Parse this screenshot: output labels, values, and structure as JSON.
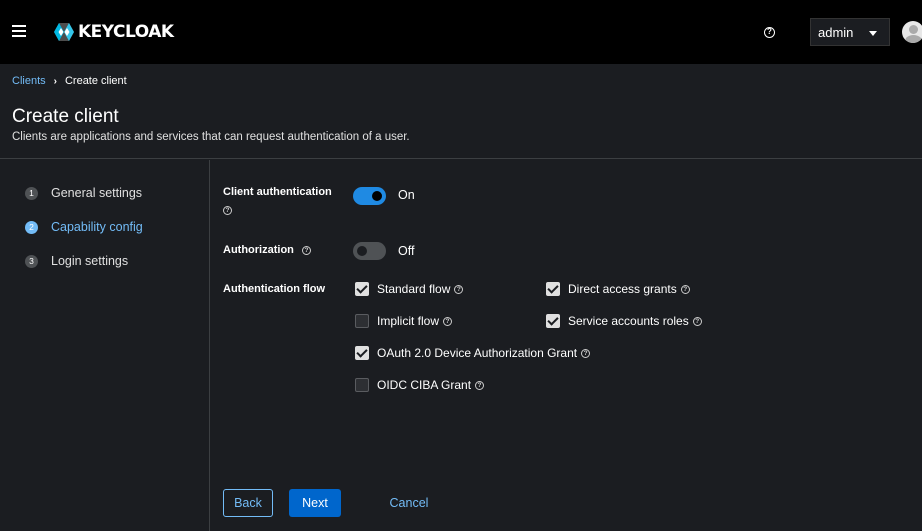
{
  "topbar": {
    "logo_text": "KEYCLOAK",
    "user_label": "admin"
  },
  "breadcrumb": {
    "parent": "Clients",
    "current": "Create client"
  },
  "page": {
    "title": "Create client",
    "description": "Clients are applications and services that can request authentication of a user."
  },
  "steps": [
    {
      "number": "1",
      "label": "General settings"
    },
    {
      "number": "2",
      "label": "Capability config"
    },
    {
      "number": "3",
      "label": "Login settings"
    }
  ],
  "form": {
    "client_auth": {
      "label": "Client authentication",
      "state": "On"
    },
    "authorization": {
      "label": "Authorization",
      "state": "Off"
    },
    "auth_flow_label": "Authentication flow",
    "flows": {
      "standard": "Standard flow",
      "direct": "Direct access grants",
      "implicit": "Implicit flow",
      "service": "Service accounts roles",
      "oauth_device": "OAuth 2.0 Device Authorization Grant",
      "ciba": "OIDC CIBA Grant"
    }
  },
  "buttons": {
    "back": "Back",
    "next": "Next",
    "cancel": "Cancel"
  },
  "colors": {
    "accent": "#73bcf7",
    "primary": "#0066cc",
    "switch_on": "#1f8ae3"
  }
}
